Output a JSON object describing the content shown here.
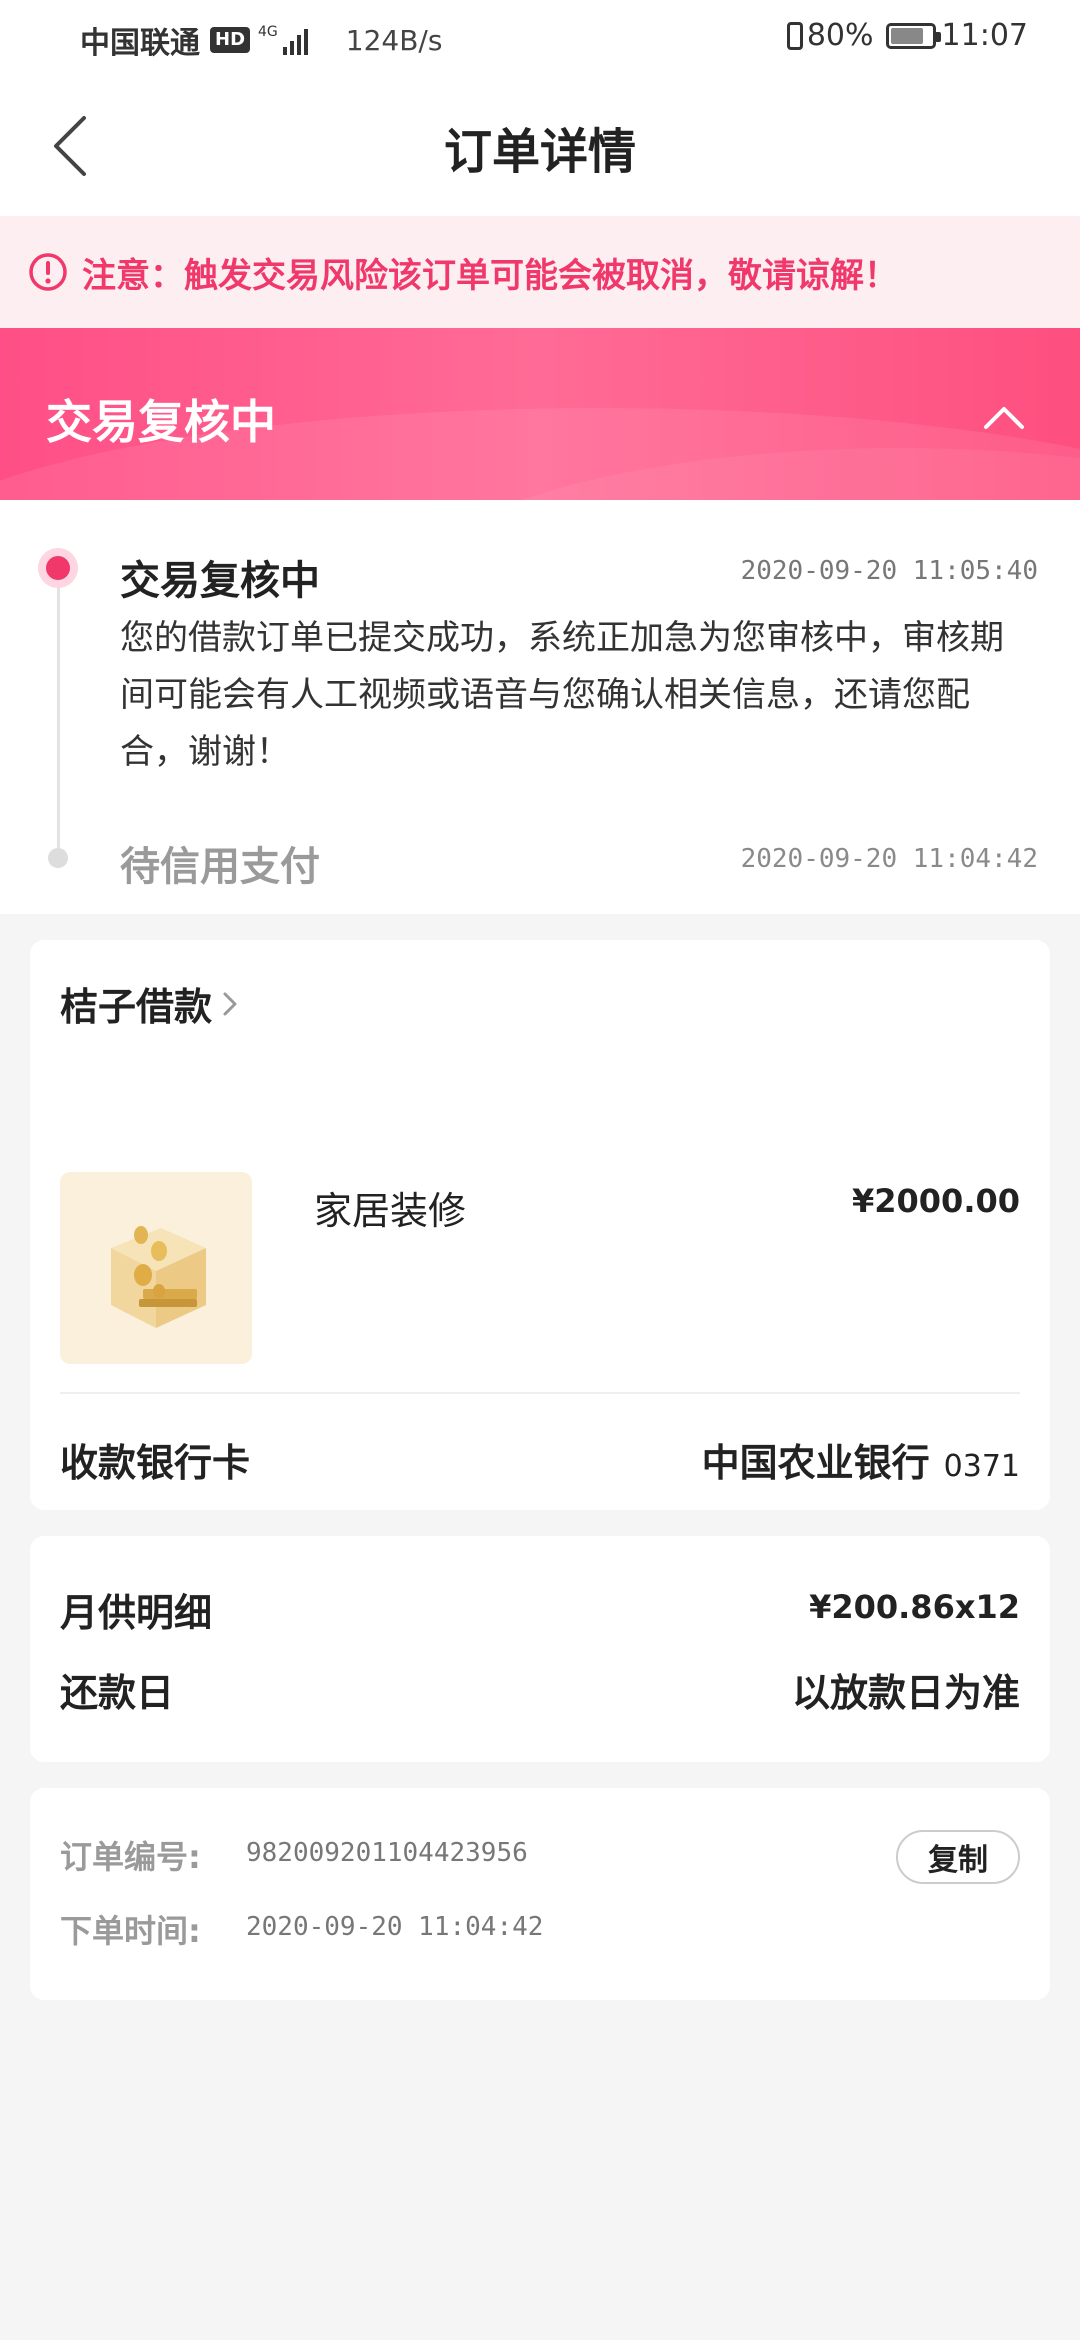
{
  "status_bar": {
    "carrier": "中国联通",
    "hd": "HD",
    "network": "4G",
    "speed": "124B/s",
    "battery": "80%",
    "time": "11:07"
  },
  "nav": {
    "title": "订单详情"
  },
  "notice": {
    "text": "注意：触发交易风险该订单可能会被取消，敬请谅解！",
    "color": "#f0386b"
  },
  "banner": {
    "title": "交易复核中",
    "accent": "#ff4f86"
  },
  "timeline": [
    {
      "title": "交易复核中",
      "time": "2020-09-20 11:05:40",
      "desc": "您的借款订单已提交成功，系统正加急为您审核中，审核期间可能会有人工视频或语音与您确认相关信息，还请您配合，谢谢！"
    },
    {
      "title": "待信用支付",
      "time": "2020-09-20 11:04:42"
    }
  ],
  "product": {
    "merchant": "桔子借款",
    "item_name": "家居装修",
    "item_price": "¥2000.00",
    "bank_label": "收款银行卡",
    "bank_name": "中国农业银行",
    "bank_suffix": "0371"
  },
  "repayment": {
    "monthly_label": "月供明细",
    "monthly_value": "¥200.86x12",
    "date_label": "还款日",
    "date_value": "以放款日为准"
  },
  "order": {
    "number_label": "订单编号:",
    "number_value": "982009201104423956",
    "copy_label": "复制",
    "time_label": "下单时间:",
    "time_value": "2020-09-20 11:04:42"
  }
}
